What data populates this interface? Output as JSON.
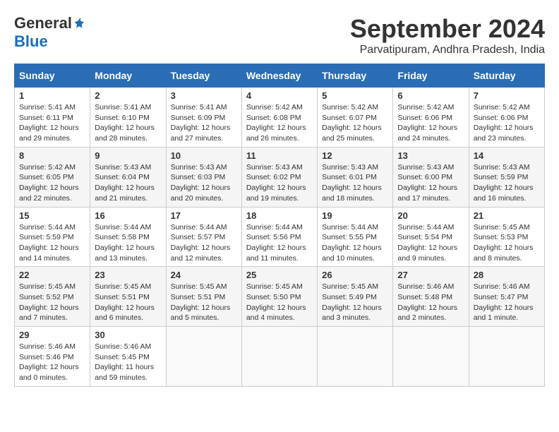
{
  "header": {
    "logo_general": "General",
    "logo_blue": "Blue",
    "month_title": "September 2024",
    "location": "Parvatipuram, Andhra Pradesh, India"
  },
  "days_of_week": [
    "Sunday",
    "Monday",
    "Tuesday",
    "Wednesday",
    "Thursday",
    "Friday",
    "Saturday"
  ],
  "weeks": [
    [
      {
        "day": "1",
        "info": "Sunrise: 5:41 AM\nSunset: 6:11 PM\nDaylight: 12 hours\nand 29 minutes."
      },
      {
        "day": "2",
        "info": "Sunrise: 5:41 AM\nSunset: 6:10 PM\nDaylight: 12 hours\nand 28 minutes."
      },
      {
        "day": "3",
        "info": "Sunrise: 5:41 AM\nSunset: 6:09 PM\nDaylight: 12 hours\nand 27 minutes."
      },
      {
        "day": "4",
        "info": "Sunrise: 5:42 AM\nSunset: 6:08 PM\nDaylight: 12 hours\nand 26 minutes."
      },
      {
        "day": "5",
        "info": "Sunrise: 5:42 AM\nSunset: 6:07 PM\nDaylight: 12 hours\nand 25 minutes."
      },
      {
        "day": "6",
        "info": "Sunrise: 5:42 AM\nSunset: 6:06 PM\nDaylight: 12 hours\nand 24 minutes."
      },
      {
        "day": "7",
        "info": "Sunrise: 5:42 AM\nSunset: 6:06 PM\nDaylight: 12 hours\nand 23 minutes."
      }
    ],
    [
      {
        "day": "8",
        "info": "Sunrise: 5:42 AM\nSunset: 6:05 PM\nDaylight: 12 hours\nand 22 minutes."
      },
      {
        "day": "9",
        "info": "Sunrise: 5:43 AM\nSunset: 6:04 PM\nDaylight: 12 hours\nand 21 minutes."
      },
      {
        "day": "10",
        "info": "Sunrise: 5:43 AM\nSunset: 6:03 PM\nDaylight: 12 hours\nand 20 minutes."
      },
      {
        "day": "11",
        "info": "Sunrise: 5:43 AM\nSunset: 6:02 PM\nDaylight: 12 hours\nand 19 minutes."
      },
      {
        "day": "12",
        "info": "Sunrise: 5:43 AM\nSunset: 6:01 PM\nDaylight: 12 hours\nand 18 minutes."
      },
      {
        "day": "13",
        "info": "Sunrise: 5:43 AM\nSunset: 6:00 PM\nDaylight: 12 hours\nand 17 minutes."
      },
      {
        "day": "14",
        "info": "Sunrise: 5:43 AM\nSunset: 5:59 PM\nDaylight: 12 hours\nand 16 minutes."
      }
    ],
    [
      {
        "day": "15",
        "info": "Sunrise: 5:44 AM\nSunset: 5:59 PM\nDaylight: 12 hours\nand 14 minutes."
      },
      {
        "day": "16",
        "info": "Sunrise: 5:44 AM\nSunset: 5:58 PM\nDaylight: 12 hours\nand 13 minutes."
      },
      {
        "day": "17",
        "info": "Sunrise: 5:44 AM\nSunset: 5:57 PM\nDaylight: 12 hours\nand 12 minutes."
      },
      {
        "day": "18",
        "info": "Sunrise: 5:44 AM\nSunset: 5:56 PM\nDaylight: 12 hours\nand 11 minutes."
      },
      {
        "day": "19",
        "info": "Sunrise: 5:44 AM\nSunset: 5:55 PM\nDaylight: 12 hours\nand 10 minutes."
      },
      {
        "day": "20",
        "info": "Sunrise: 5:44 AM\nSunset: 5:54 PM\nDaylight: 12 hours\nand 9 minutes."
      },
      {
        "day": "21",
        "info": "Sunrise: 5:45 AM\nSunset: 5:53 PM\nDaylight: 12 hours\nand 8 minutes."
      }
    ],
    [
      {
        "day": "22",
        "info": "Sunrise: 5:45 AM\nSunset: 5:52 PM\nDaylight: 12 hours\nand 7 minutes."
      },
      {
        "day": "23",
        "info": "Sunrise: 5:45 AM\nSunset: 5:51 PM\nDaylight: 12 hours\nand 6 minutes."
      },
      {
        "day": "24",
        "info": "Sunrise: 5:45 AM\nSunset: 5:51 PM\nDaylight: 12 hours\nand 5 minutes."
      },
      {
        "day": "25",
        "info": "Sunrise: 5:45 AM\nSunset: 5:50 PM\nDaylight: 12 hours\nand 4 minutes."
      },
      {
        "day": "26",
        "info": "Sunrise: 5:45 AM\nSunset: 5:49 PM\nDaylight: 12 hours\nand 3 minutes."
      },
      {
        "day": "27",
        "info": "Sunrise: 5:46 AM\nSunset: 5:48 PM\nDaylight: 12 hours\nand 2 minutes."
      },
      {
        "day": "28",
        "info": "Sunrise: 5:46 AM\nSunset: 5:47 PM\nDaylight: 12 hours\nand 1 minute."
      }
    ],
    [
      {
        "day": "29",
        "info": "Sunrise: 5:46 AM\nSunset: 5:46 PM\nDaylight: 12 hours\nand 0 minutes."
      },
      {
        "day": "30",
        "info": "Sunrise: 5:46 AM\nSunset: 5:45 PM\nDaylight: 11 hours\nand 59 minutes."
      },
      {
        "day": "",
        "info": ""
      },
      {
        "day": "",
        "info": ""
      },
      {
        "day": "",
        "info": ""
      },
      {
        "day": "",
        "info": ""
      },
      {
        "day": "",
        "info": ""
      }
    ]
  ]
}
